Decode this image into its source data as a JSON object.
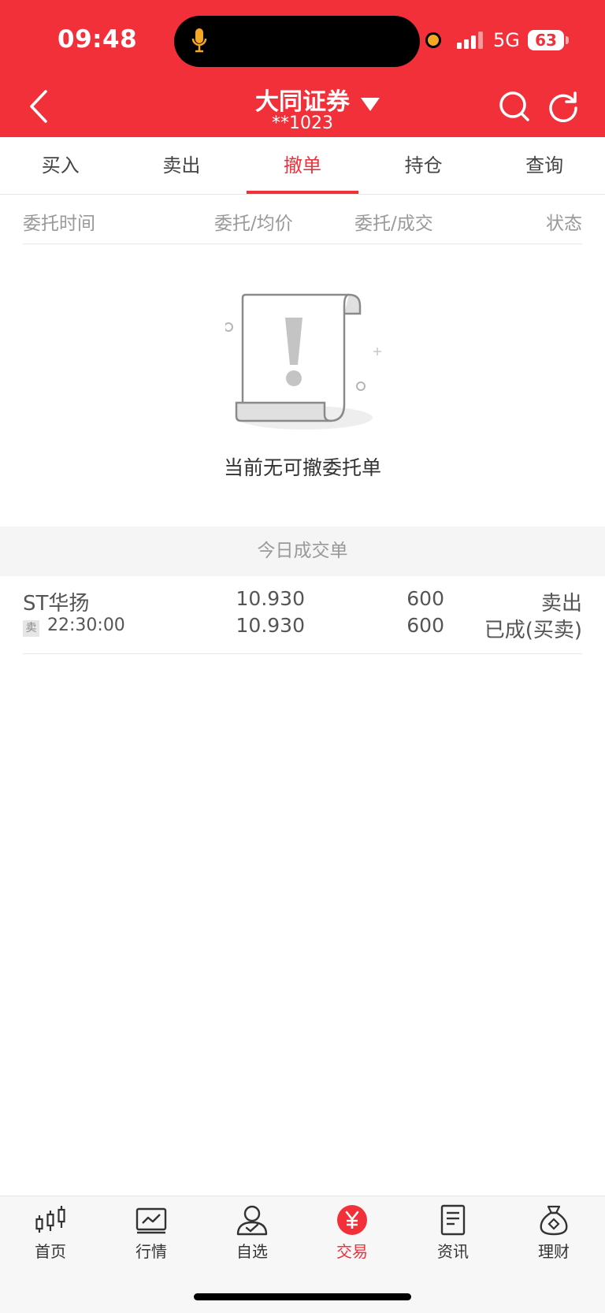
{
  "status_bar": {
    "time": "09:48",
    "network": "5G",
    "battery": "63"
  },
  "header": {
    "broker": "大同证券",
    "account": "**1023",
    "accent_color": "#f2303a"
  },
  "tabs": [
    {
      "label": "买入"
    },
    {
      "label": "卖出"
    },
    {
      "label": "撤单",
      "active": true
    },
    {
      "label": "持仓"
    },
    {
      "label": "查询"
    }
  ],
  "columns": {
    "time": "委托时间",
    "price": "委托/均价",
    "qty": "委托/成交",
    "status": "状态"
  },
  "empty_state": {
    "icon": "warning-scroll-icon",
    "text": "当前无可撤委托单"
  },
  "today_trades": {
    "title": "今日成交单",
    "rows": [
      {
        "name": "ST华扬",
        "side_badge": "卖",
        "time": "22:30:00",
        "order_price": "10.930",
        "avg_price": "10.930",
        "order_qty": "600",
        "filled_qty": "600",
        "direction": "卖出",
        "status": "已成(买卖)"
      }
    ]
  },
  "bottom_nav": [
    {
      "label": "首页",
      "icon": "candlestick-icon"
    },
    {
      "label": "行情",
      "icon": "trend-chart-icon"
    },
    {
      "label": "自选",
      "icon": "user-check-icon"
    },
    {
      "label": "交易",
      "icon": "yuan-icon",
      "active": true
    },
    {
      "label": "资讯",
      "icon": "document-icon"
    },
    {
      "label": "理财",
      "icon": "money-bag-icon"
    }
  ]
}
